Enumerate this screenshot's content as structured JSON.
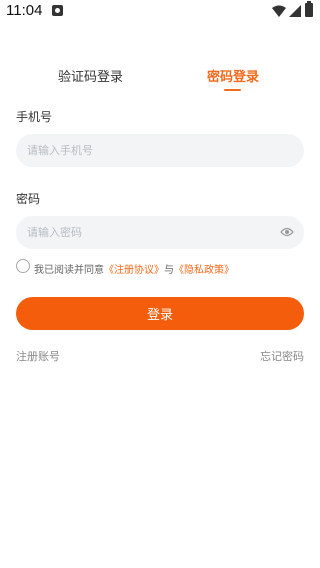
{
  "status_bar": {
    "time": "11:04"
  },
  "tabs": [
    {
      "label": "验证码登录",
      "active": false
    },
    {
      "label": "密码登录",
      "active": true
    }
  ],
  "form": {
    "phone_label": "手机号",
    "phone_placeholder": "请输入手机号",
    "password_label": "密码",
    "password_placeholder": "请输入密码"
  },
  "agreement": {
    "prefix": "我已阅读并同意",
    "terms_link": "《注册协议》",
    "conjunction": "与",
    "privacy_link": "《隐私政策》"
  },
  "login_button": "登录",
  "links": {
    "register": "注册账号",
    "forgot": "忘记密码"
  },
  "colors": {
    "accent": "#f26a1b",
    "button": "#f45d0b",
    "input_bg": "#f2f4f6"
  },
  "icons": [
    "notification-icon",
    "wifi-icon",
    "signal-icon",
    "battery-icon",
    "eye-icon"
  ]
}
